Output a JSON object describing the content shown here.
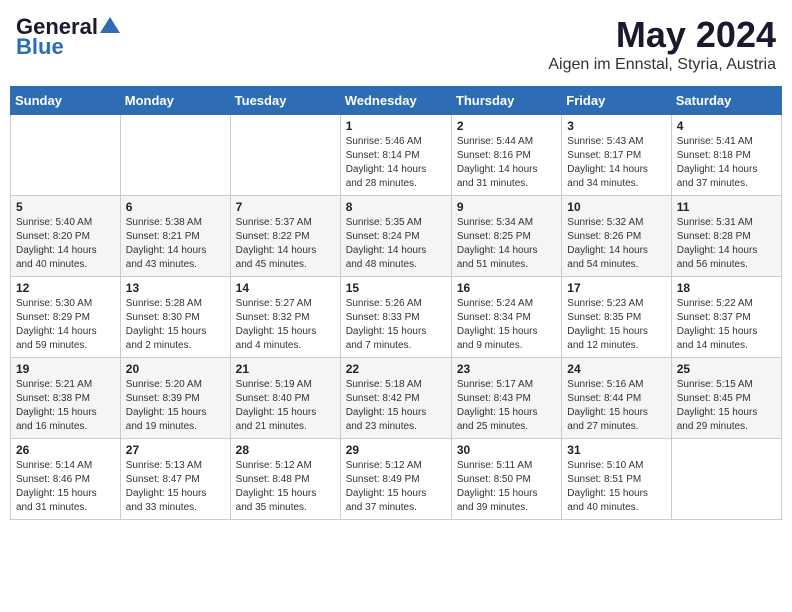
{
  "header": {
    "logo_general": "General",
    "logo_blue": "Blue",
    "title": "May 2024",
    "subtitle": "Aigen im Ennstal, Styria, Austria"
  },
  "columns": [
    "Sunday",
    "Monday",
    "Tuesday",
    "Wednesday",
    "Thursday",
    "Friday",
    "Saturday"
  ],
  "rows": [
    [
      {
        "day": "",
        "info": ""
      },
      {
        "day": "",
        "info": ""
      },
      {
        "day": "",
        "info": ""
      },
      {
        "day": "1",
        "info": "Sunrise: 5:46 AM\nSunset: 8:14 PM\nDaylight: 14 hours\nand 28 minutes."
      },
      {
        "day": "2",
        "info": "Sunrise: 5:44 AM\nSunset: 8:16 PM\nDaylight: 14 hours\nand 31 minutes."
      },
      {
        "day": "3",
        "info": "Sunrise: 5:43 AM\nSunset: 8:17 PM\nDaylight: 14 hours\nand 34 minutes."
      },
      {
        "day": "4",
        "info": "Sunrise: 5:41 AM\nSunset: 8:18 PM\nDaylight: 14 hours\nand 37 minutes."
      }
    ],
    [
      {
        "day": "5",
        "info": "Sunrise: 5:40 AM\nSunset: 8:20 PM\nDaylight: 14 hours\nand 40 minutes."
      },
      {
        "day": "6",
        "info": "Sunrise: 5:38 AM\nSunset: 8:21 PM\nDaylight: 14 hours\nand 43 minutes."
      },
      {
        "day": "7",
        "info": "Sunrise: 5:37 AM\nSunset: 8:22 PM\nDaylight: 14 hours\nand 45 minutes."
      },
      {
        "day": "8",
        "info": "Sunrise: 5:35 AM\nSunset: 8:24 PM\nDaylight: 14 hours\nand 48 minutes."
      },
      {
        "day": "9",
        "info": "Sunrise: 5:34 AM\nSunset: 8:25 PM\nDaylight: 14 hours\nand 51 minutes."
      },
      {
        "day": "10",
        "info": "Sunrise: 5:32 AM\nSunset: 8:26 PM\nDaylight: 14 hours\nand 54 minutes."
      },
      {
        "day": "11",
        "info": "Sunrise: 5:31 AM\nSunset: 8:28 PM\nDaylight: 14 hours\nand 56 minutes."
      }
    ],
    [
      {
        "day": "12",
        "info": "Sunrise: 5:30 AM\nSunset: 8:29 PM\nDaylight: 14 hours\nand 59 minutes."
      },
      {
        "day": "13",
        "info": "Sunrise: 5:28 AM\nSunset: 8:30 PM\nDaylight: 15 hours\nand 2 minutes."
      },
      {
        "day": "14",
        "info": "Sunrise: 5:27 AM\nSunset: 8:32 PM\nDaylight: 15 hours\nand 4 minutes."
      },
      {
        "day": "15",
        "info": "Sunrise: 5:26 AM\nSunset: 8:33 PM\nDaylight: 15 hours\nand 7 minutes."
      },
      {
        "day": "16",
        "info": "Sunrise: 5:24 AM\nSunset: 8:34 PM\nDaylight: 15 hours\nand 9 minutes."
      },
      {
        "day": "17",
        "info": "Sunrise: 5:23 AM\nSunset: 8:35 PM\nDaylight: 15 hours\nand 12 minutes."
      },
      {
        "day": "18",
        "info": "Sunrise: 5:22 AM\nSunset: 8:37 PM\nDaylight: 15 hours\nand 14 minutes."
      }
    ],
    [
      {
        "day": "19",
        "info": "Sunrise: 5:21 AM\nSunset: 8:38 PM\nDaylight: 15 hours\nand 16 minutes."
      },
      {
        "day": "20",
        "info": "Sunrise: 5:20 AM\nSunset: 8:39 PM\nDaylight: 15 hours\nand 19 minutes."
      },
      {
        "day": "21",
        "info": "Sunrise: 5:19 AM\nSunset: 8:40 PM\nDaylight: 15 hours\nand 21 minutes."
      },
      {
        "day": "22",
        "info": "Sunrise: 5:18 AM\nSunset: 8:42 PM\nDaylight: 15 hours\nand 23 minutes."
      },
      {
        "day": "23",
        "info": "Sunrise: 5:17 AM\nSunset: 8:43 PM\nDaylight: 15 hours\nand 25 minutes."
      },
      {
        "day": "24",
        "info": "Sunrise: 5:16 AM\nSunset: 8:44 PM\nDaylight: 15 hours\nand 27 minutes."
      },
      {
        "day": "25",
        "info": "Sunrise: 5:15 AM\nSunset: 8:45 PM\nDaylight: 15 hours\nand 29 minutes."
      }
    ],
    [
      {
        "day": "26",
        "info": "Sunrise: 5:14 AM\nSunset: 8:46 PM\nDaylight: 15 hours\nand 31 minutes."
      },
      {
        "day": "27",
        "info": "Sunrise: 5:13 AM\nSunset: 8:47 PM\nDaylight: 15 hours\nand 33 minutes."
      },
      {
        "day": "28",
        "info": "Sunrise: 5:12 AM\nSunset: 8:48 PM\nDaylight: 15 hours\nand 35 minutes."
      },
      {
        "day": "29",
        "info": "Sunrise: 5:12 AM\nSunset: 8:49 PM\nDaylight: 15 hours\nand 37 minutes."
      },
      {
        "day": "30",
        "info": "Sunrise: 5:11 AM\nSunset: 8:50 PM\nDaylight: 15 hours\nand 39 minutes."
      },
      {
        "day": "31",
        "info": "Sunrise: 5:10 AM\nSunset: 8:51 PM\nDaylight: 15 hours\nand 40 minutes."
      },
      {
        "day": "",
        "info": ""
      }
    ]
  ]
}
